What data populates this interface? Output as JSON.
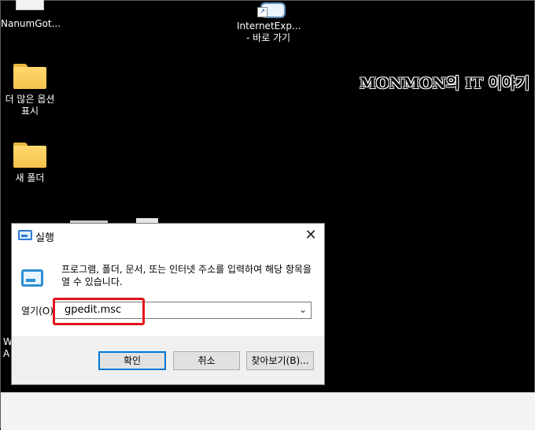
{
  "desktop": {
    "icons": [
      {
        "label_line1": "NanumGot...",
        "label_line2": ""
      },
      {
        "label_line1": "InternetExp...",
        "label_line2": "- 바로 가기"
      },
      {
        "label_line1": "더 많은 옵션",
        "label_line2": "표시"
      },
      {
        "label_line1": "새 폴더",
        "label_line2": ""
      }
    ],
    "brand_text": "MONMON의 IT 이야기",
    "partial_texts": [
      "W",
      "A"
    ]
  },
  "dialog": {
    "title": "실행",
    "close_glyph": "✕",
    "description": "프로그램, 폴더, 문서, 또는 인터넷 주소를 입력하여 해당 항목을 열 수 있습니다.",
    "open_label": "열기(O):",
    "input_value": "gpedit.msc",
    "dropdown_glyph": "⌄",
    "buttons": {
      "ok": "확인",
      "cancel": "취소",
      "browse": "찾아보기(B)..."
    }
  },
  "colors": {
    "highlight": "#e0141b",
    "accent": "#0078d7"
  }
}
